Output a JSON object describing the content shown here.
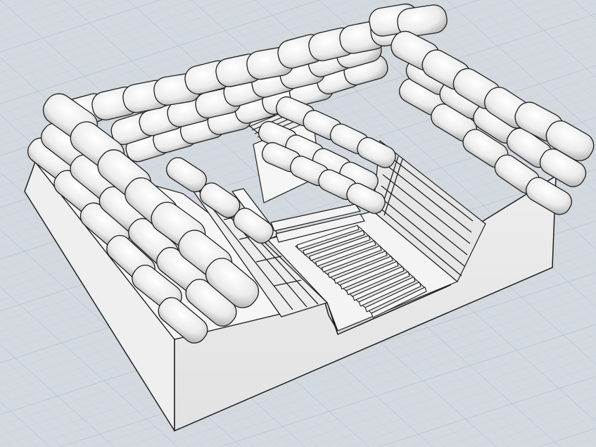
{
  "viewport": {
    "view_mode": "perspective",
    "shading": "shaded-with-edges",
    "grid_visible": true
  },
  "colors": {
    "background": "#d3d9df",
    "grid_minor": "#c6ced6",
    "grid_major": "#b5bec8",
    "model_light": "#f2f2f2",
    "model_mid": "#dcdcdc",
    "model_dark": "#b3b3b3",
    "edge": "#1f1f1f"
  },
  "model": {
    "object_type": "sandbag-trench-model",
    "parts": [
      "base-block",
      "sandbag-walls",
      "trench-floor",
      "duckboard",
      "plank-revetment",
      "dugout-opening"
    ]
  }
}
